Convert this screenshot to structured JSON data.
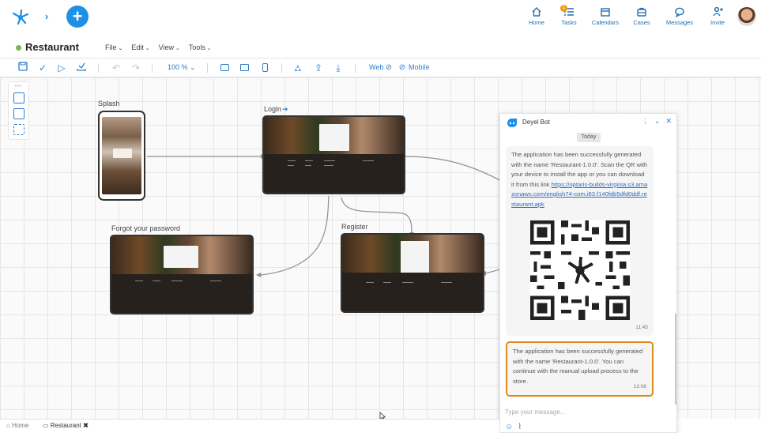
{
  "topnav": {
    "items": [
      {
        "label": "Home",
        "icon": "home-icon"
      },
      {
        "label": "Tasks",
        "icon": "tasks-icon",
        "badge": "1"
      },
      {
        "label": "Calendars",
        "icon": "calendar-icon"
      },
      {
        "label": "Cases",
        "icon": "cases-icon"
      },
      {
        "label": "Messages",
        "icon": "messages-icon"
      },
      {
        "label": "Invite",
        "icon": "invite-icon"
      }
    ],
    "accent": "#1e90e6"
  },
  "app": {
    "title": "Restaurant",
    "status_color": "#7ab648"
  },
  "menus": [
    "File",
    "Edit",
    "View",
    "Tools"
  ],
  "toolbar": {
    "zoom": "100 % ⌄",
    "web_label": "Web",
    "mobile_label": "Mobile"
  },
  "canvas": {
    "nodes": [
      {
        "label": "Splash"
      },
      {
        "label": "Login"
      },
      {
        "label": "Forgot your password"
      },
      {
        "label": "Register"
      }
    ]
  },
  "chat": {
    "bot_name": "Deyel Bot",
    "day": "Today",
    "messages": [
      {
        "text": "The application has been successfully generated with the name 'Restaurant-1.0.0'. Scan the QR with your device to install the app or you can download it from this link",
        "link": "https://optaris-builds-virginia.s3.amazonaws.com/english74-com.i83.f140fdb5dfd0ddf.restaurant.apk",
        "time": "11:45"
      },
      {
        "text": "The application has been successfully generated with the name 'Restaurant-1.0.0'. You can continue with the manual upload process to the store.",
        "time": "12:06",
        "highlight": "#e08b1b"
      }
    ],
    "input_placeholder": "Type your message..."
  },
  "bottom_tabs": [
    {
      "label": "Home"
    },
    {
      "label": "Restaurant",
      "close": "✖"
    }
  ]
}
